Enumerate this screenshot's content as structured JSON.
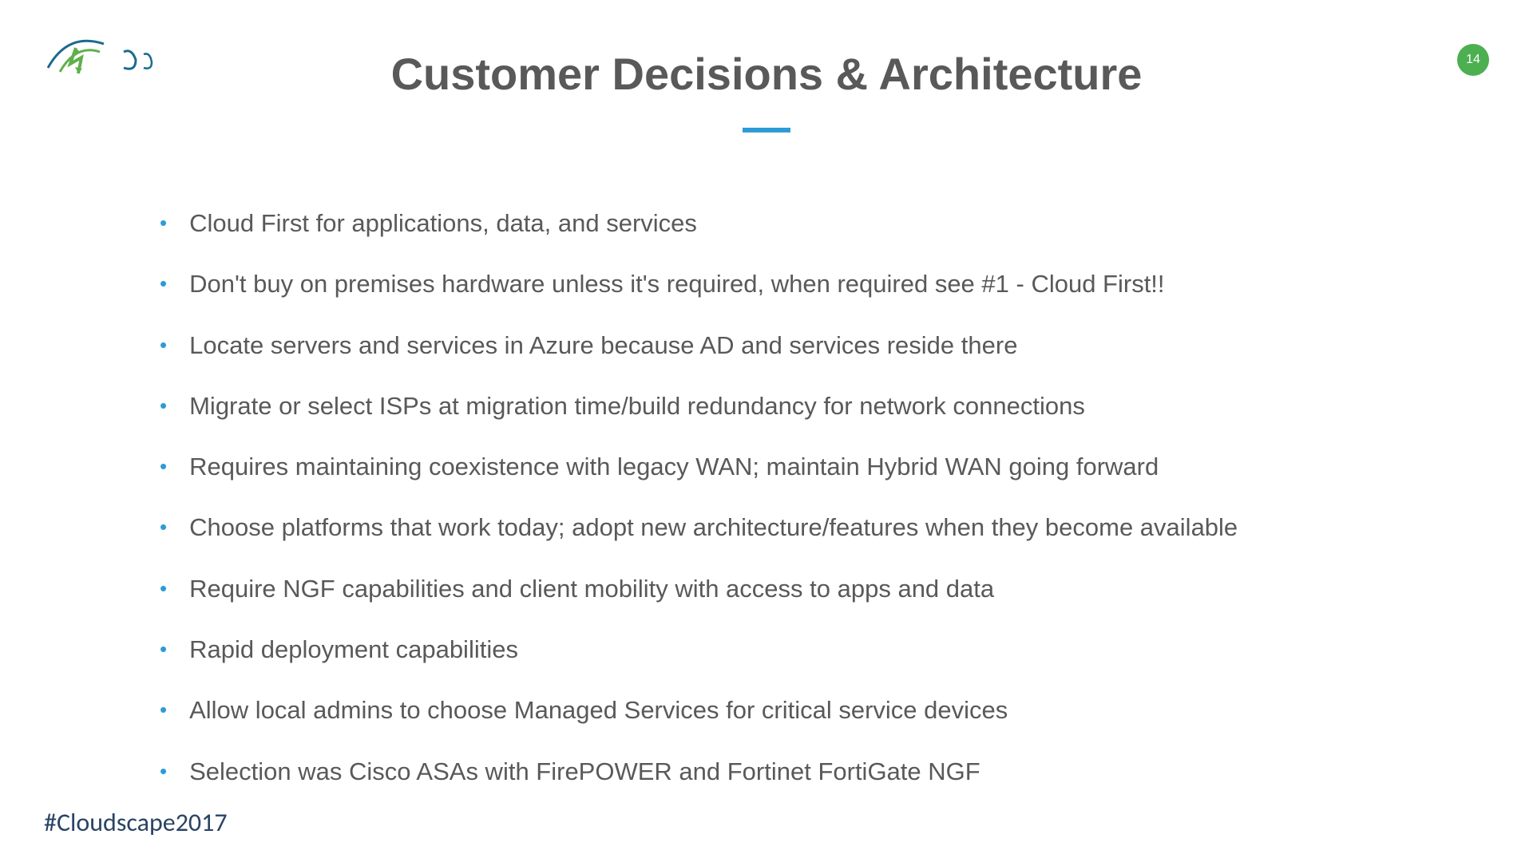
{
  "title": "Customer Decisions & Architecture",
  "pageNumber": "14",
  "bullets": [
    "Cloud First for applications, data, and services",
    "Don't buy on premises hardware unless it's required, when required see #1 - Cloud First!!",
    "Locate servers and services in Azure because AD and services reside there",
    "Migrate or select ISPs at migration time/build redundancy for network connections",
    "Requires maintaining coexistence with legacy WAN; maintain Hybrid WAN going forward",
    "Choose platforms that work today; adopt new architecture/features when they become available",
    "Require NGF capabilities and client mobility with access to apps and data",
    "Rapid deployment capabilities",
    "Allow local admins to choose Managed Services for critical service devices",
    "Selection was Cisco ASAs with FirePOWER and Fortinet FortiGate NGF"
  ],
  "footerTag": "#Cloudscape2017"
}
